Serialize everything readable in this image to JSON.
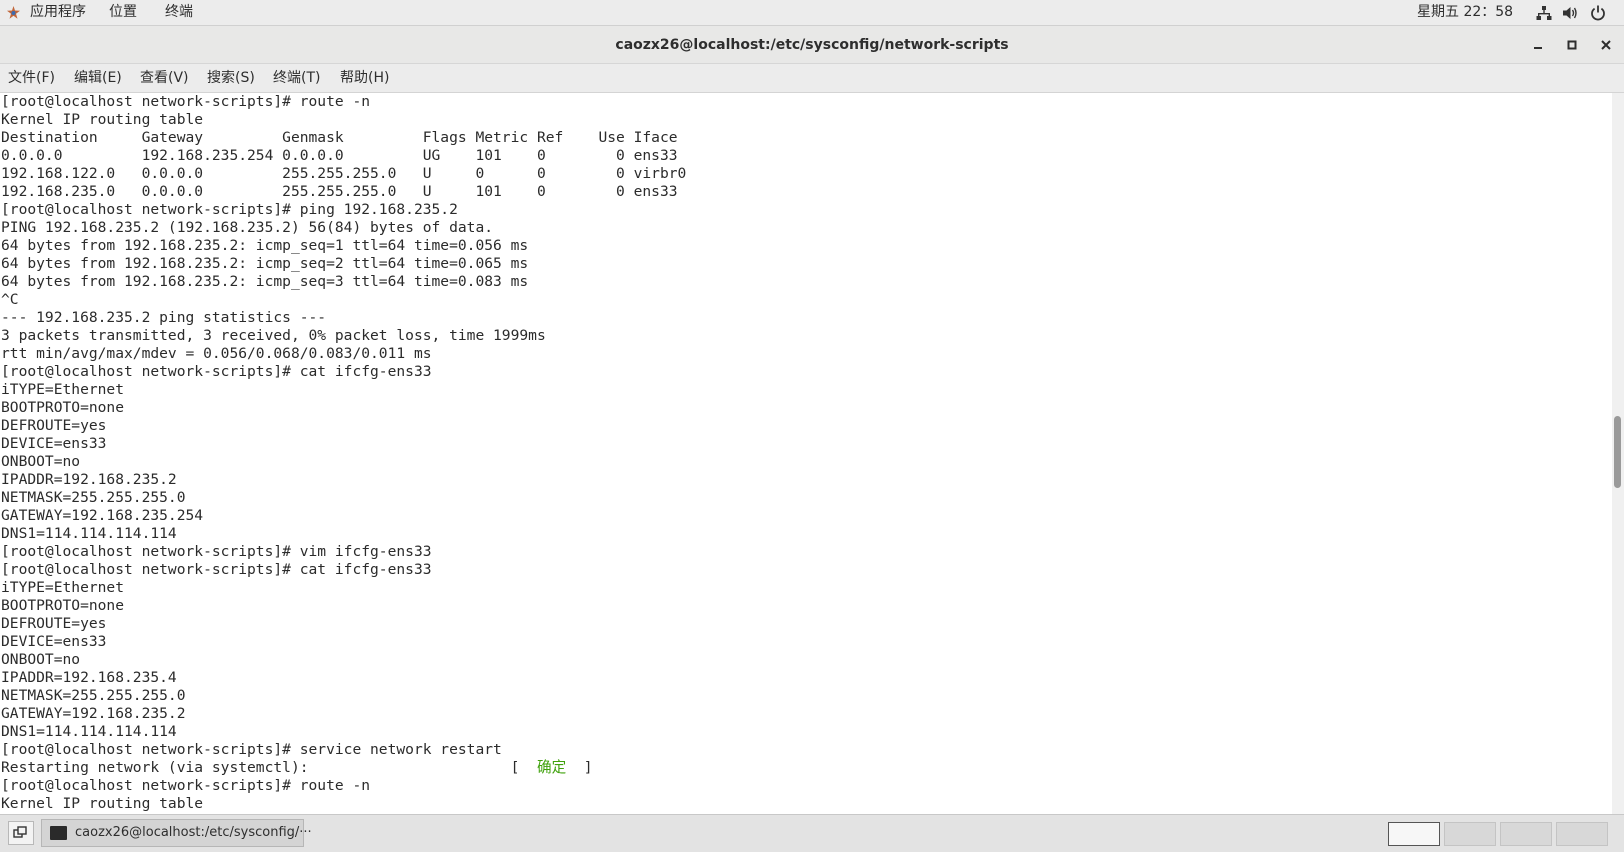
{
  "topbar": {
    "apps": "应用程序",
    "places": "位置",
    "terminal": "终端",
    "clock": "星期五 22：58",
    "icons": [
      "network-icon",
      "volume-icon",
      "power-icon"
    ]
  },
  "window": {
    "title": "caozx26@localhost:/etc/sysconfig/network-scripts",
    "buttons": [
      "minimize-icon",
      "maximize-icon",
      "close-icon"
    ]
  },
  "menubar": {
    "file": "文件(F)",
    "edit": "编辑(E)",
    "view": "查看(V)",
    "search": "搜索(S)",
    "terminal": "终端(T)",
    "help": "帮助(H)"
  },
  "terminal": {
    "lines": [
      "[root@localhost network-scripts]# route -n",
      "Kernel IP routing table",
      "Destination     Gateway         Genmask         Flags Metric Ref    Use Iface",
      "0.0.0.0         192.168.235.254 0.0.0.0         UG    101    0        0 ens33",
      "192.168.122.0   0.0.0.0         255.255.255.0   U     0      0        0 virbr0",
      "192.168.235.0   0.0.0.0         255.255.255.0   U     101    0        0 ens33",
      "[root@localhost network-scripts]# ping 192.168.235.2",
      "PING 192.168.235.2 (192.168.235.2) 56(84) bytes of data.",
      "64 bytes from 192.168.235.2: icmp_seq=1 ttl=64 time=0.056 ms",
      "64 bytes from 192.168.235.2: icmp_seq=2 ttl=64 time=0.065 ms",
      "64 bytes from 192.168.235.2: icmp_seq=3 ttl=64 time=0.083 ms",
      "^C",
      "--- 192.168.235.2 ping statistics ---",
      "3 packets transmitted, 3 received, 0% packet loss, time 1999ms",
      "rtt min/avg/max/mdev = 0.056/0.068/0.083/0.011 ms",
      "[root@localhost network-scripts]# cat ifcfg-ens33",
      "iTYPE=Ethernet",
      "BOOTPROTO=none",
      "DEFROUTE=yes",
      "DEVICE=ens33",
      "ONBOOT=no",
      "IPADDR=192.168.235.2",
      "NETMASK=255.255.255.0",
      "GATEWAY=192.168.235.254",
      "DNS1=114.114.114.114",
      "[root@localhost network-scripts]# vim ifcfg-ens33",
      "[root@localhost network-scripts]# cat ifcfg-ens33",
      "iTYPE=Ethernet",
      "BOOTPROTO=none",
      "DEFROUTE=yes",
      "DEVICE=ens33",
      "ONBOOT=no",
      "IPADDR=192.168.235.4",
      "NETMASK=255.255.255.0",
      "GATEWAY=192.168.235.2",
      "DNS1=114.114.114.114",
      "[root@localhost network-scripts]# service network restart",
      "RESTART_LINE",
      "[root@localhost network-scripts]# route -n",
      "Kernel IP routing table"
    ],
    "restart_prefix": "Restarting network (via systemctl):",
    "restart_ok": "确定",
    "ok_color": "#3fa10c"
  },
  "taskbar": {
    "task_label": "caozx26@localhost:/etc/sysconfig/···",
    "workspaces": 4
  }
}
